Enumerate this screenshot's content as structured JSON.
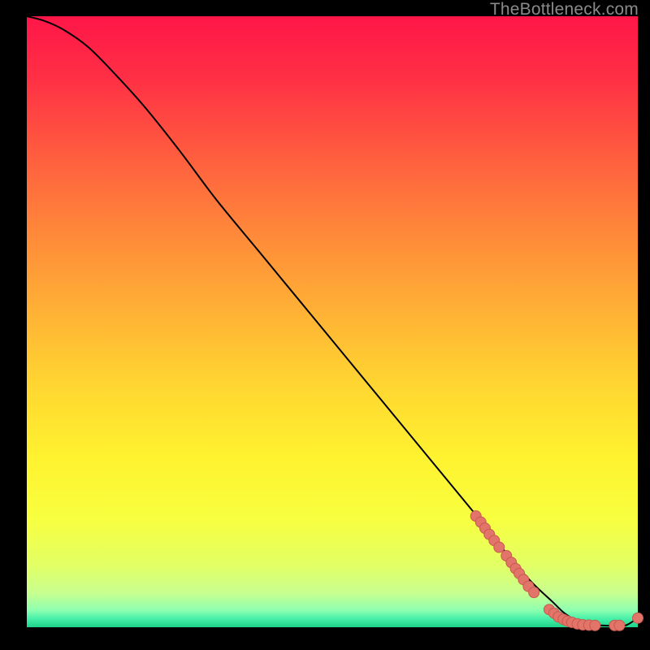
{
  "watermark": "TheBottleneck.com",
  "colors": {
    "dot_fill": "#e2746a",
    "dot_stroke": "#c75a50",
    "curve": "#000000",
    "gradient_stops": [
      {
        "offset": 0.0,
        "color": "#ff1648"
      },
      {
        "offset": 0.1,
        "color": "#ff2f45"
      },
      {
        "offset": 0.22,
        "color": "#ff5a3f"
      },
      {
        "offset": 0.35,
        "color": "#ff873a"
      },
      {
        "offset": 0.48,
        "color": "#ffb035"
      },
      {
        "offset": 0.6,
        "color": "#ffd531"
      },
      {
        "offset": 0.72,
        "color": "#fff22f"
      },
      {
        "offset": 0.82,
        "color": "#f8ff3e"
      },
      {
        "offset": 0.9,
        "color": "#e2ff66"
      },
      {
        "offset": 0.944,
        "color": "#c8ff90"
      },
      {
        "offset": 0.972,
        "color": "#8effb0"
      },
      {
        "offset": 0.986,
        "color": "#47f0a8"
      },
      {
        "offset": 1.0,
        "color": "#1fd38a"
      }
    ]
  },
  "chart_data": {
    "type": "line",
    "title": "",
    "xlabel": "",
    "ylabel": "",
    "xlim": [
      0,
      100
    ],
    "ylim": [
      0,
      100
    ],
    "series": [
      {
        "name": "curve",
        "x": [
          0,
          3,
          6,
          10,
          14,
          19,
          25,
          31,
          38,
          45,
          52,
          59,
          66,
          73,
          77,
          80,
          83,
          86,
          88,
          90,
          92,
          94,
          96,
          98,
          100
        ],
        "y": [
          100,
          99.2,
          97.8,
          95,
          91,
          85.5,
          78,
          70,
          61.5,
          53,
          44.5,
          36,
          27.5,
          19,
          14,
          10.3,
          7,
          4.2,
          2.3,
          1.1,
          0.5,
          0.3,
          0.25,
          0.3,
          1.5
        ]
      },
      {
        "name": "dots",
        "x": [
          73.5,
          74.3,
          75.0,
          75.7,
          76.5,
          77.3,
          78.5,
          79.3,
          80.0,
          80.6,
          81.3,
          82.1,
          83.0,
          85.5,
          86.3,
          87.0,
          87.8,
          88.5,
          89.2,
          90.1,
          91.0,
          92.0,
          93.0,
          96.2,
          97.0,
          100.0
        ],
        "y": [
          18.2,
          17.2,
          16.2,
          15.2,
          14.2,
          13.1,
          11.7,
          10.6,
          9.6,
          8.8,
          7.8,
          6.7,
          5.7,
          2.9,
          2.3,
          1.7,
          1.3,
          1.0,
          0.8,
          0.55,
          0.4,
          0.35,
          0.3,
          0.3,
          0.3,
          1.5
        ]
      }
    ]
  }
}
